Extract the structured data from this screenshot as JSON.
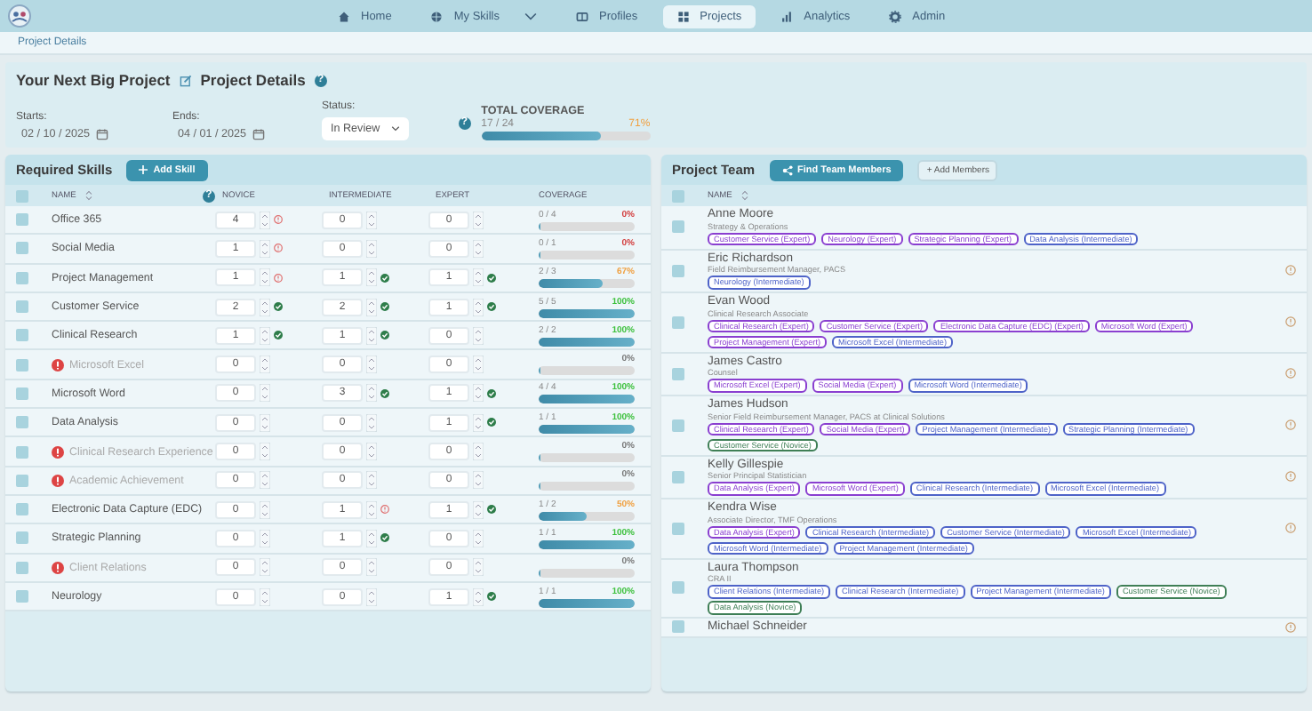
{
  "nav": {
    "items": [
      {
        "label": "Home",
        "selected": false,
        "has_menu": false
      },
      {
        "label": "My Skills",
        "selected": false,
        "has_menu": true
      },
      {
        "label": "Profiles",
        "selected": false,
        "has_menu": false
      },
      {
        "label": "Projects",
        "selected": true,
        "has_menu": false
      },
      {
        "label": "Analytics",
        "selected": false,
        "has_menu": false
      },
      {
        "label": "Admin",
        "selected": false,
        "has_menu": false
      }
    ]
  },
  "breadcrumb": "Project Details",
  "project": {
    "name": "Your Next Big Project",
    "section_title": "Project Details",
    "help": "?",
    "starts": {
      "label": "Starts:",
      "value": "02 / 10 / 2025"
    },
    "ends": {
      "label": "Ends:",
      "value": "04 / 01 / 2025"
    },
    "status": {
      "label": "Status:",
      "value": "In Review"
    },
    "coverage": {
      "help": "?",
      "title": "TOTAL COVERAGE",
      "fraction": "17 / 24",
      "percent": "71%",
      "color": "#f0a040",
      "level": 0.71
    }
  },
  "skills": {
    "title": "Required Skills",
    "add_button": "Add Skill",
    "all_checked": false,
    "name_help": "?",
    "columns": [
      "NAME",
      "NOVICE",
      "INTERMEDIATE",
      "EXPERT",
      "COVERAGE"
    ],
    "rows": [
      {
        "name": "Office 365",
        "warning": false,
        "checked": false,
        "levels": [
          {
            "value": "4",
            "met": false,
            "short": true
          },
          {
            "value": "0",
            "met": false,
            "short": false
          },
          {
            "value": "0",
            "met": false,
            "short": false
          }
        ],
        "fraction": "0 / 4",
        "percent": "0%",
        "color": "#d23c3c",
        "level": 0
      },
      {
        "name": "Social Media",
        "warning": false,
        "checked": false,
        "levels": [
          {
            "value": "1",
            "met": false,
            "short": true
          },
          {
            "value": "0",
            "met": false,
            "short": false
          },
          {
            "value": "0",
            "met": false,
            "short": false
          }
        ],
        "fraction": "0 / 1",
        "percent": "0%",
        "color": "#d23c3c",
        "level": 0
      },
      {
        "name": "Project Management",
        "warning": false,
        "checked": false,
        "levels": [
          {
            "value": "1",
            "met": false,
            "short": true
          },
          {
            "value": "1",
            "met": true,
            "short": false
          },
          {
            "value": "1",
            "met": true,
            "short": false
          }
        ],
        "fraction": "2 / 3",
        "percent": "67%",
        "color": "#f0a040",
        "level": 0.67
      },
      {
        "name": "Customer Service",
        "warning": false,
        "checked": false,
        "levels": [
          {
            "value": "2",
            "met": true,
            "short": false
          },
          {
            "value": "2",
            "met": true,
            "short": false
          },
          {
            "value": "1",
            "met": true,
            "short": false
          }
        ],
        "fraction": "5 / 5",
        "percent": "100%",
        "color": "#3cc03c",
        "level": 1
      },
      {
        "name": "Clinical Research",
        "warning": false,
        "checked": false,
        "levels": [
          {
            "value": "1",
            "met": true,
            "short": false
          },
          {
            "value": "1",
            "met": true,
            "short": false
          },
          {
            "value": "0",
            "met": false,
            "short": false
          }
        ],
        "fraction": "2 / 2",
        "percent": "100%",
        "color": "#3cc03c",
        "level": 1
      },
      {
        "name": "Microsoft Excel",
        "warning": true,
        "checked": false,
        "levels": [
          {
            "value": "0",
            "met": false,
            "short": false
          },
          {
            "value": "0",
            "met": false,
            "short": false
          },
          {
            "value": "0",
            "met": false,
            "short": false
          }
        ],
        "percent": "0%",
        "color": "#777777",
        "level": 0
      },
      {
        "name": "Microsoft Word",
        "warning": false,
        "checked": false,
        "levels": [
          {
            "value": "0",
            "met": false,
            "short": false
          },
          {
            "value": "3",
            "met": true,
            "short": false
          },
          {
            "value": "1",
            "met": true,
            "short": false
          }
        ],
        "fraction": "4 / 4",
        "percent": "100%",
        "color": "#3cc03c",
        "level": 1
      },
      {
        "name": "Data Analysis",
        "warning": false,
        "checked": false,
        "levels": [
          {
            "value": "0",
            "met": false,
            "short": false
          },
          {
            "value": "0",
            "met": false,
            "short": false
          },
          {
            "value": "1",
            "met": true,
            "short": false
          }
        ],
        "fraction": "1 / 1",
        "percent": "100%",
        "color": "#3cc03c",
        "level": 1
      },
      {
        "name": "Clinical Research Experience",
        "warning": true,
        "checked": false,
        "levels": [
          {
            "value": "0",
            "met": false,
            "short": false
          },
          {
            "value": "0",
            "met": false,
            "short": false
          },
          {
            "value": "0",
            "met": false,
            "short": false
          }
        ],
        "percent": "0%",
        "color": "#777777",
        "level": 0
      },
      {
        "name": "Academic Achievement",
        "warning": true,
        "checked": false,
        "levels": [
          {
            "value": "0",
            "met": false,
            "short": false
          },
          {
            "value": "0",
            "met": false,
            "short": false
          },
          {
            "value": "0",
            "met": false,
            "short": false
          }
        ],
        "percent": "0%",
        "color": "#777777",
        "level": 0
      },
      {
        "name": "Electronic Data Capture (EDC)",
        "warning": false,
        "checked": false,
        "levels": [
          {
            "value": "0",
            "met": false,
            "short": false
          },
          {
            "value": "1",
            "met": false,
            "short": true
          },
          {
            "value": "1",
            "met": true,
            "short": false
          }
        ],
        "fraction": "1 / 2",
        "percent": "50%",
        "color": "#f0a040",
        "level": 0.5
      },
      {
        "name": "Strategic Planning",
        "warning": false,
        "checked": false,
        "levels": [
          {
            "value": "0",
            "met": false,
            "short": false
          },
          {
            "value": "1",
            "met": true,
            "short": false
          },
          {
            "value": "0",
            "met": false,
            "short": false
          }
        ],
        "fraction": "1 / 1",
        "percent": "100%",
        "color": "#3cc03c",
        "level": 1
      },
      {
        "name": "Client Relations",
        "warning": true,
        "checked": false,
        "levels": [
          {
            "value": "0",
            "met": false,
            "short": false
          },
          {
            "value": "0",
            "met": false,
            "short": false
          },
          {
            "value": "0",
            "met": false,
            "short": false
          }
        ],
        "percent": "0%",
        "color": "#777777",
        "level": 0
      },
      {
        "name": "Neurology",
        "warning": false,
        "checked": false,
        "levels": [
          {
            "value": "0",
            "met": false,
            "short": false
          },
          {
            "value": "0",
            "met": false,
            "short": false
          },
          {
            "value": "1",
            "met": true,
            "short": false
          }
        ],
        "fraction": "1 / 1",
        "percent": "100%",
        "color": "#3cc03c",
        "level": 1
      }
    ]
  },
  "team": {
    "title": "Project Team",
    "find_button": "Find Team Members",
    "add_button": "+ Add Members",
    "all_checked": false,
    "columns": [
      "NAME"
    ],
    "members": [
      {
        "name": "Anne Moore",
        "title": "Strategy & Operations",
        "flagged": false,
        "checked": false,
        "tags": [
          {
            "label": "Customer Service (Expert)",
            "color": "#8a3fd0"
          },
          {
            "label": "Neurology (Expert)",
            "color": "#8a3fd0"
          },
          {
            "label": "Strategic Planning (Expert)",
            "color": "#8a3fd0"
          },
          {
            "label": "Data Analysis (Intermediate)",
            "color": "#4e63c8"
          }
        ]
      },
      {
        "name": "Eric Richardson",
        "title": "Field Reimbursement Manager, PACS",
        "flagged": true,
        "checked": false,
        "tags": [
          {
            "label": "Neurology (Intermediate)",
            "color": "#4e63c8"
          }
        ]
      },
      {
        "name": "Evan Wood",
        "title": "Clinical Research Associate",
        "flagged": true,
        "checked": false,
        "tags": [
          {
            "label": "Clinical Research (Expert)",
            "color": "#8a3fd0"
          },
          {
            "label": "Customer Service (Expert)",
            "color": "#8a3fd0"
          },
          {
            "label": "Electronic Data Capture (EDC) (Expert)",
            "color": "#8a3fd0"
          },
          {
            "label": "Microsoft Word (Expert)",
            "color": "#8a3fd0"
          },
          {
            "label": "Project Management (Expert)",
            "color": "#8a3fd0"
          },
          {
            "label": "Microsoft Excel (Intermediate)",
            "color": "#4e63c8"
          }
        ]
      },
      {
        "name": "James Castro",
        "title": "Counsel",
        "flagged": true,
        "checked": false,
        "tags": [
          {
            "label": "Microsoft Excel (Expert)",
            "color": "#8a3fd0"
          },
          {
            "label": "Social Media (Expert)",
            "color": "#8a3fd0"
          },
          {
            "label": "Microsoft Word (Intermediate)",
            "color": "#4e63c8"
          }
        ]
      },
      {
        "name": "James Hudson",
        "title": "Senior Field Reimbursement Manager, PACS at Clinical Solutions",
        "flagged": true,
        "checked": false,
        "tags": [
          {
            "label": "Clinical Research (Expert)",
            "color": "#8a3fd0"
          },
          {
            "label": "Social Media (Expert)",
            "color": "#8a3fd0"
          },
          {
            "label": "Project Management (Intermediate)",
            "color": "#4e63c8"
          },
          {
            "label": "Strategic Planning (Intermediate)",
            "color": "#4e63c8"
          },
          {
            "label": "Customer Service (Novice)",
            "color": "#3f7f56"
          }
        ]
      },
      {
        "name": "Kelly Gillespie",
        "title": "Senior Principal Statistician",
        "flagged": true,
        "checked": false,
        "tags": [
          {
            "label": "Data Analysis (Expert)",
            "color": "#8a3fd0"
          },
          {
            "label": "Microsoft Word (Expert)",
            "color": "#8a3fd0"
          },
          {
            "label": "Clinical Research (Intermediate)",
            "color": "#4e63c8"
          },
          {
            "label": "Microsoft Excel (Intermediate)",
            "color": "#4e63c8"
          }
        ]
      },
      {
        "name": "Kendra Wise",
        "title": "Associate Director, TMF Operations",
        "flagged": true,
        "checked": false,
        "tags": [
          {
            "label": "Data Analysis (Expert)",
            "color": "#8a3fd0"
          },
          {
            "label": "Clinical Research (Intermediate)",
            "color": "#4e63c8"
          },
          {
            "label": "Customer Service (Intermediate)",
            "color": "#4e63c8"
          },
          {
            "label": "Microsoft Excel (Intermediate)",
            "color": "#4e63c8"
          },
          {
            "label": "Microsoft Word (Intermediate)",
            "color": "#4e63c8"
          },
          {
            "label": "Project Management (Intermediate)",
            "color": "#4e63c8"
          }
        ]
      },
      {
        "name": "Laura Thompson",
        "title": "CRA II",
        "flagged": false,
        "checked": false,
        "tags": [
          {
            "label": "Client Relations (Intermediate)",
            "color": "#4e63c8"
          },
          {
            "label": "Clinical Research (Intermediate)",
            "color": "#4e63c8"
          },
          {
            "label": "Project Management (Intermediate)",
            "color": "#4e63c8"
          },
          {
            "label": "Customer Service (Novice)",
            "color": "#3f7f56"
          },
          {
            "label": "Data Analysis (Novice)",
            "color": "#3f7f56"
          }
        ]
      },
      {
        "name": "Michael Schneider",
        "flagged": true,
        "checked": false
      }
    ]
  }
}
